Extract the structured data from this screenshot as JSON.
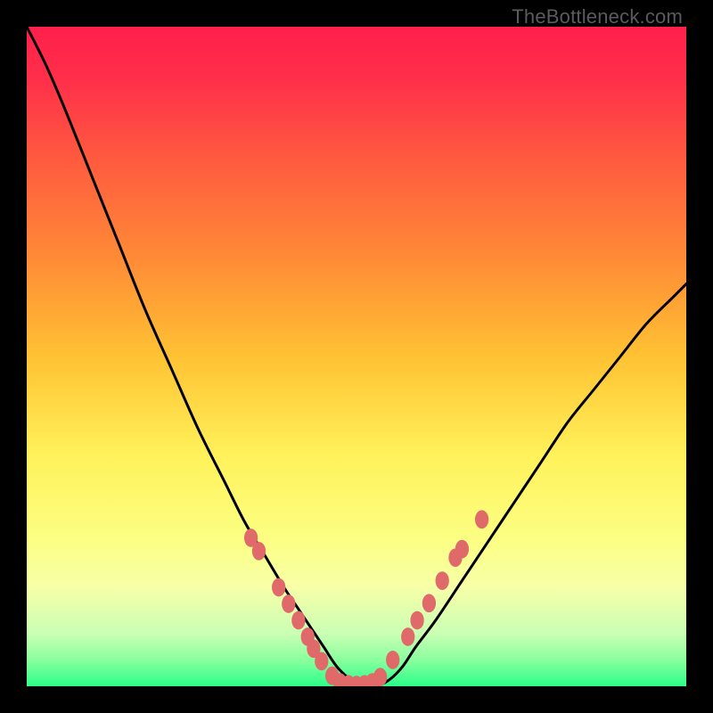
{
  "watermark": "TheBottleneck.com",
  "chart_data": {
    "type": "line",
    "title": "",
    "xlabel": "",
    "ylabel": "",
    "xlim": [
      0,
      100
    ],
    "ylim": [
      0,
      100
    ],
    "background_gradient": {
      "stops": [
        {
          "offset": 0.0,
          "color": "#ff1f4b"
        },
        {
          "offset": 0.08,
          "color": "#ff2f4a"
        },
        {
          "offset": 0.2,
          "color": "#ff5a3f"
        },
        {
          "offset": 0.35,
          "color": "#ff8a36"
        },
        {
          "offset": 0.5,
          "color": "#ffc233"
        },
        {
          "offset": 0.65,
          "color": "#fff25a"
        },
        {
          "offset": 0.78,
          "color": "#fcff84"
        },
        {
          "offset": 0.85,
          "color": "#f7ffa8"
        },
        {
          "offset": 0.92,
          "color": "#caffb4"
        },
        {
          "offset": 0.96,
          "color": "#8aff9e"
        },
        {
          "offset": 1.0,
          "color": "#2bff8a"
        }
      ]
    },
    "series": [
      {
        "name": "curve",
        "color": "#000000",
        "stroke_width": 3,
        "x": [
          0,
          3,
          6,
          10,
          14,
          18,
          22,
          26,
          30,
          33,
          36,
          39,
          41,
          43,
          45,
          47,
          49,
          50,
          51,
          53,
          55,
          57,
          59,
          62,
          66,
          70,
          74,
          78,
          82,
          86,
          90,
          94,
          98,
          100
        ],
        "y": [
          100,
          94,
          87,
          77,
          67,
          57,
          48,
          39,
          31,
          25,
          20,
          15,
          12,
          9,
          6,
          3,
          1,
          0,
          0,
          0,
          1,
          3,
          6,
          10,
          16,
          22,
          28,
          34,
          40,
          45,
          50,
          55,
          59,
          61
        ]
      }
    ],
    "markers": {
      "color": "#e06a6a",
      "radius": 9,
      "points": [
        {
          "x": 34.0,
          "y": 22.5
        },
        {
          "x": 35.2,
          "y": 20.5
        },
        {
          "x": 38.2,
          "y": 15.0
        },
        {
          "x": 39.7,
          "y": 12.5
        },
        {
          "x": 41.2,
          "y": 10.0
        },
        {
          "x": 42.6,
          "y": 7.5
        },
        {
          "x": 43.5,
          "y": 5.7
        },
        {
          "x": 44.7,
          "y": 3.8
        },
        {
          "x": 46.3,
          "y": 1.6
        },
        {
          "x": 47.5,
          "y": 0.6
        },
        {
          "x": 48.8,
          "y": 0.3
        },
        {
          "x": 50.0,
          "y": 0.2
        },
        {
          "x": 51.2,
          "y": 0.3
        },
        {
          "x": 52.4,
          "y": 0.6
        },
        {
          "x": 53.6,
          "y": 1.4
        },
        {
          "x": 55.5,
          "y": 4.0
        },
        {
          "x": 57.8,
          "y": 7.5
        },
        {
          "x": 59.2,
          "y": 10.0
        },
        {
          "x": 61.0,
          "y": 12.6
        },
        {
          "x": 63.0,
          "y": 16.0
        },
        {
          "x": 65.0,
          "y": 19.5
        },
        {
          "x": 66.0,
          "y": 20.8
        },
        {
          "x": 69.0,
          "y": 25.3
        }
      ]
    }
  }
}
